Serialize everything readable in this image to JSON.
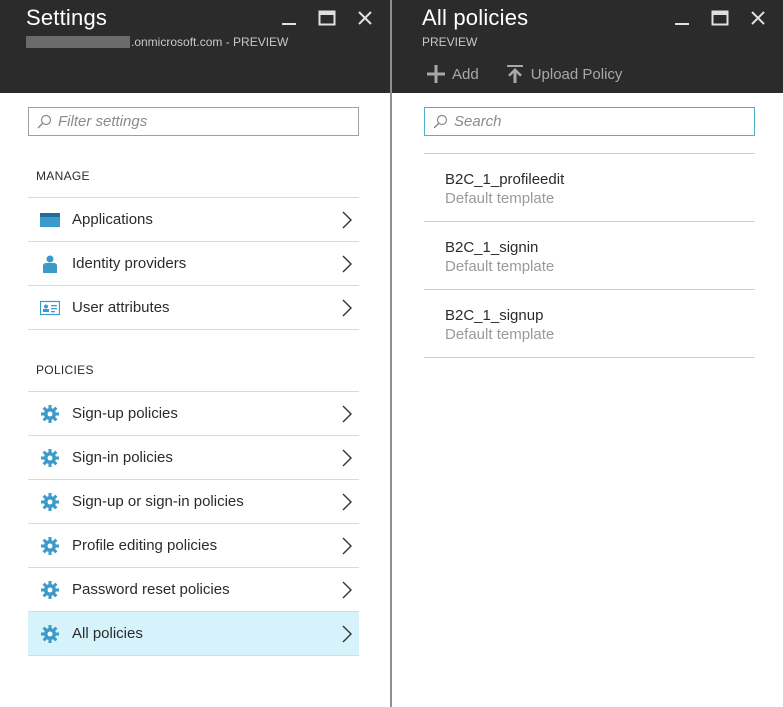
{
  "settings_blade": {
    "title": "Settings",
    "subtitle": ".onmicrosoft.com - PREVIEW",
    "filter_placeholder": "Filter settings",
    "sections": [
      {
        "heading": "MANAGE",
        "items": [
          {
            "label": "Applications",
            "icon": "applications-icon"
          },
          {
            "label": "Identity providers",
            "icon": "person-icon"
          },
          {
            "label": "User attributes",
            "icon": "id-card-icon"
          }
        ]
      },
      {
        "heading": "POLICIES",
        "items": [
          {
            "label": "Sign-up policies",
            "icon": "gear-icon"
          },
          {
            "label": "Sign-in policies",
            "icon": "gear-icon"
          },
          {
            "label": "Sign-up or sign-in policies",
            "icon": "gear-icon"
          },
          {
            "label": "Profile editing policies",
            "icon": "gear-icon"
          },
          {
            "label": "Password reset policies",
            "icon": "gear-icon"
          },
          {
            "label": "All policies",
            "icon": "gear-icon",
            "selected": true
          }
        ]
      }
    ]
  },
  "policies_blade": {
    "title": "All policies",
    "subtitle": "PREVIEW",
    "commands": [
      {
        "label": "Add",
        "icon": "plus-icon"
      },
      {
        "label": "Upload Policy",
        "icon": "upload-icon"
      }
    ],
    "search_placeholder": "Search",
    "policies": [
      {
        "name": "B2C_1_profileedit",
        "description": "Default template"
      },
      {
        "name": "B2C_1_signin",
        "description": "Default template"
      },
      {
        "name": "B2C_1_signup",
        "description": "Default template"
      }
    ]
  },
  "colors": {
    "header_bg": "#2b2b2b",
    "accent": "#3a9ac9",
    "selected_bg": "#d6f3fb",
    "search_border": "#4fb0c6"
  }
}
